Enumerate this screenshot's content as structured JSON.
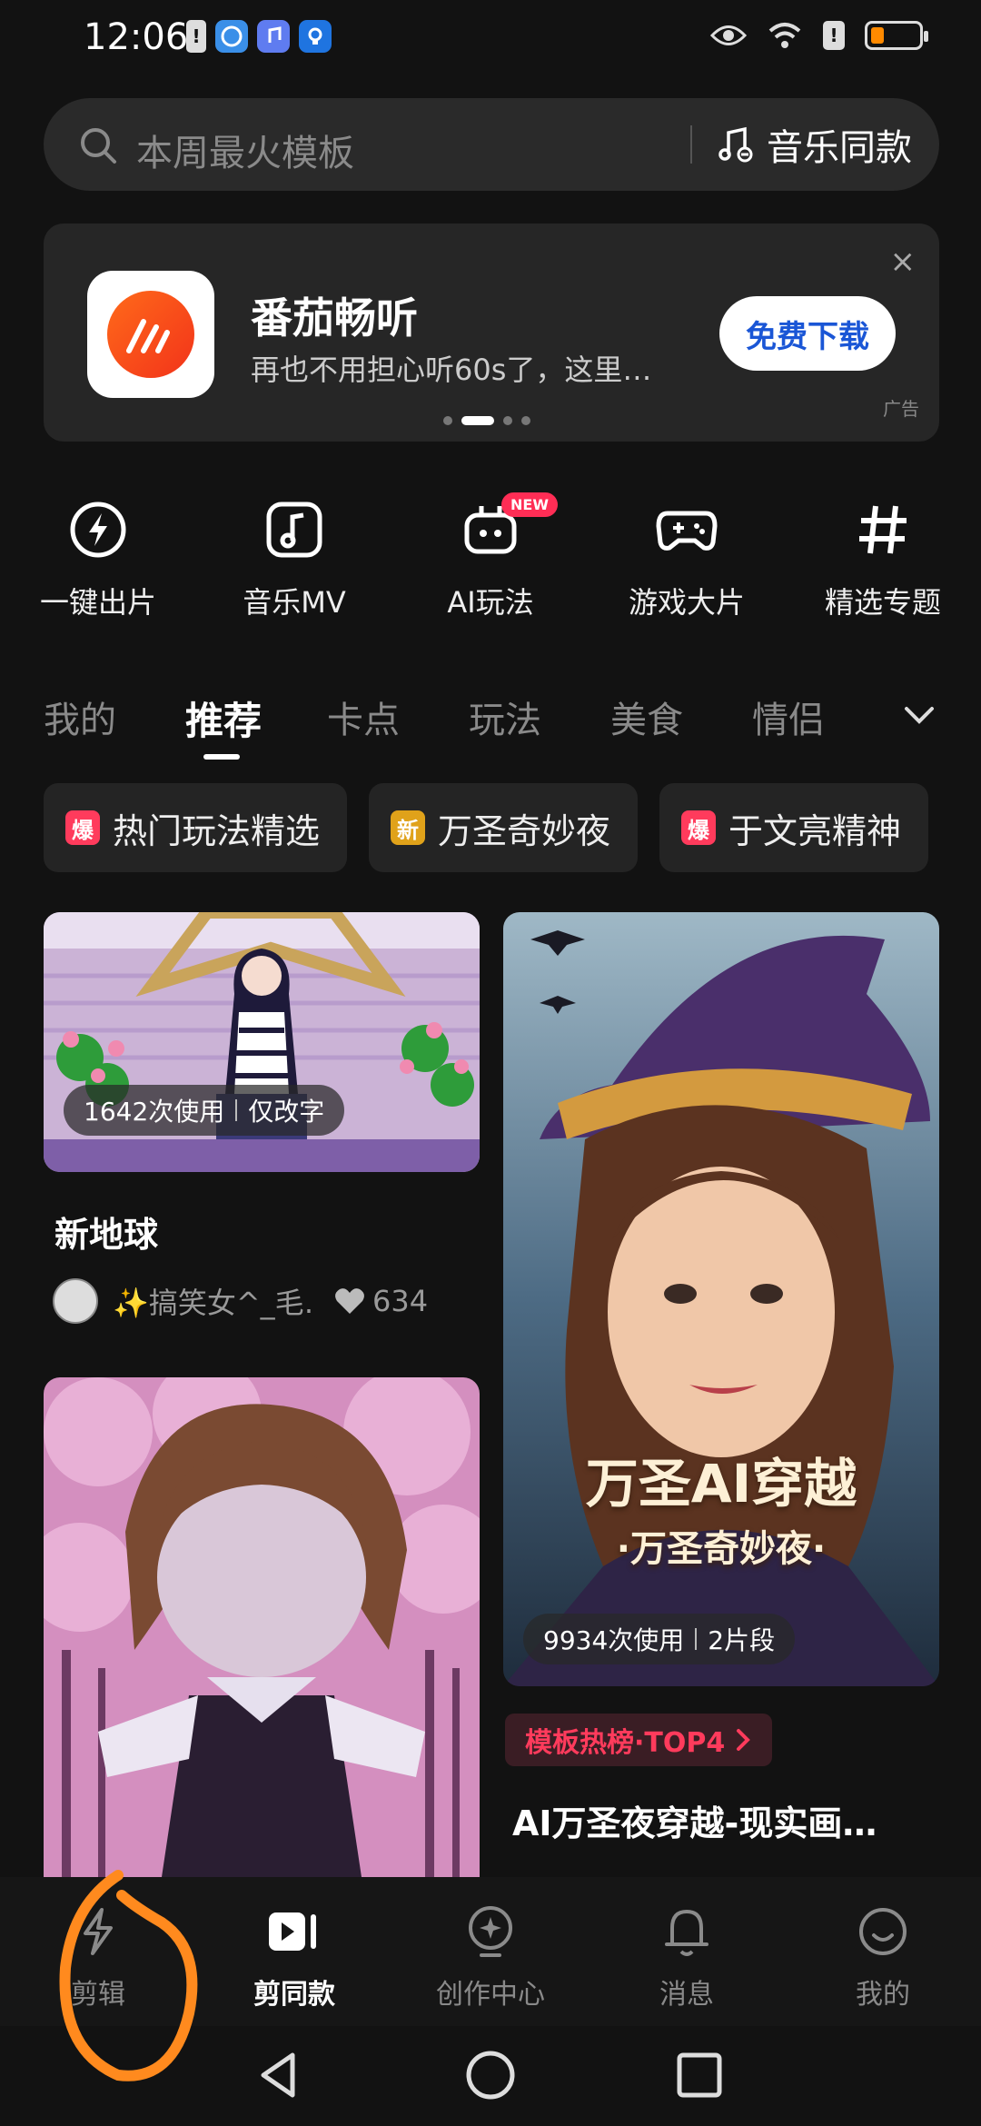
{
  "status_bar": {
    "time": "12:06"
  },
  "search": {
    "placeholder": "本周最火模板",
    "music_label": "音乐同款"
  },
  "ad": {
    "title": "番茄畅听",
    "description": "再也不用担心听60s了，这里…",
    "cta": "免费下载",
    "close": "×",
    "tag": "广告",
    "dot_count": 4,
    "active_dot": 1
  },
  "quick_actions": [
    {
      "label": "一键出片",
      "icon": "lightning-icon"
    },
    {
      "label": "音乐MV",
      "icon": "music-note-icon"
    },
    {
      "label": "AI玩法",
      "icon": "robot-icon",
      "badge": "NEW"
    },
    {
      "label": "游戏大片",
      "icon": "gamepad-icon"
    },
    {
      "label": "精选专题",
      "icon": "hashtag-icon"
    }
  ],
  "tabs": [
    {
      "label": "我的"
    },
    {
      "label": "推荐",
      "active": true
    },
    {
      "label": "卡点"
    },
    {
      "label": "玩法"
    },
    {
      "label": "美食"
    },
    {
      "label": "情侣"
    }
  ],
  "chips": [
    {
      "badge": "爆",
      "badge_color": "#ff3b5c",
      "label": "热门玩法精选"
    },
    {
      "badge": "新",
      "badge_color": "#e0a21a",
      "label": "万圣奇妙夜"
    },
    {
      "badge": "爆",
      "badge_color": "#ff3b5c",
      "label": "于文亮精神"
    }
  ],
  "feed": {
    "left_card_1": {
      "usage": "1642次使用",
      "usage_note": "仅改字",
      "title": "新地球",
      "author": "✨搞笑女^_毛…",
      "likes": "634"
    },
    "right_card_1": {
      "usage": "9934次使用",
      "usage_note": "2片段",
      "overlay_title": "万圣AI穿越",
      "overlay_subtitle": "·万圣奇妙夜·",
      "hot_tag": "模板热榜·TOP4",
      "title": "AI万圣夜穿越-现实画…"
    }
  },
  "bottom_nav": [
    {
      "label": "剪辑",
      "icon": "scissors-lightning-icon"
    },
    {
      "label": "剪同款",
      "icon": "play-template-icon",
      "active": true
    },
    {
      "label": "创作中心",
      "icon": "creator-center-icon"
    },
    {
      "label": "消息",
      "icon": "bell-icon"
    },
    {
      "label": "我的",
      "icon": "profile-smile-icon"
    }
  ],
  "colors": {
    "accent_red": "#ff3b5c",
    "background": "#121212",
    "annotation": "#ff8a1e"
  }
}
